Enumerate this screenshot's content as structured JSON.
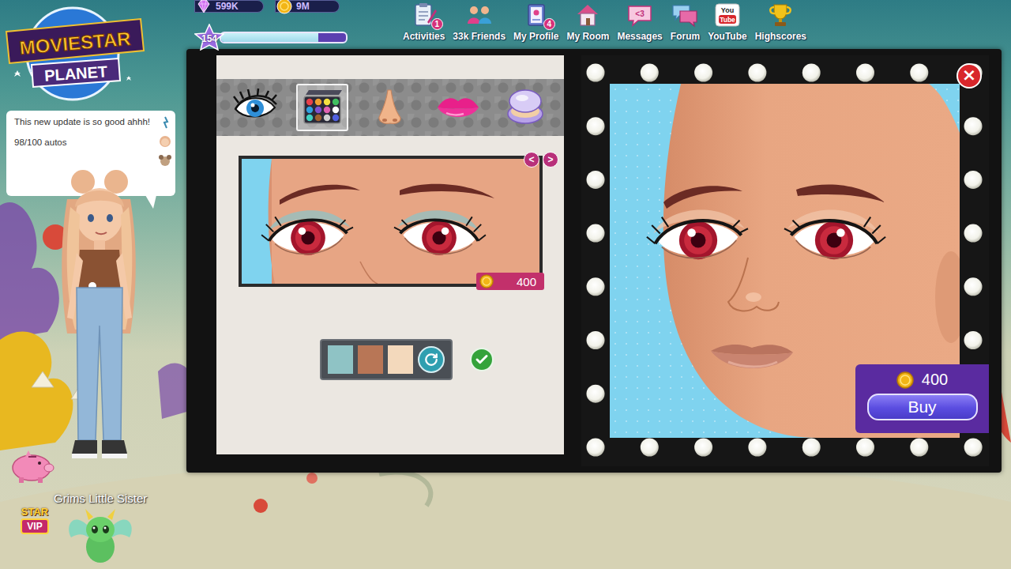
{
  "hud": {
    "diamonds": "599K",
    "coins": "9M",
    "level": "154",
    "xp": 0.78
  },
  "logo": {
    "top": "MOVIESTAR",
    "bottom": "PLANET"
  },
  "nav": [
    {
      "label": "Activities",
      "badge": "1"
    },
    {
      "label": "33k Friends"
    },
    {
      "label": "My Profile",
      "badge": "4"
    },
    {
      "label": "My Room"
    },
    {
      "label": "Messages",
      "icon_text": [
        "<3"
      ]
    },
    {
      "label": "Forum"
    },
    {
      "label": "YouTube",
      "icon_text": [
        "You",
        "Tube"
      ]
    },
    {
      "label": "Highscores"
    }
  ],
  "chat": {
    "lines": [
      "This new update is so good ahhh!",
      "98/100 autos"
    ]
  },
  "player": {
    "name": "Grims Little Sister",
    "vip_top": "STAR",
    "vip_bottom": "VIP"
  },
  "makeup_dialog": {
    "close": "×",
    "tabs": [
      {
        "kind": "eyes",
        "selected": false
      },
      {
        "kind": "eyeshadow",
        "selected": true
      },
      {
        "kind": "nose",
        "selected": false
      },
      {
        "kind": "lips",
        "selected": false
      },
      {
        "kind": "blush",
        "selected": false
      }
    ],
    "preview": {
      "prev": "<",
      "next": ">",
      "price": "400"
    },
    "swatches": [
      {
        "color": "#8fc3c5"
      },
      {
        "color": "#b87656"
      },
      {
        "color": "#f3d9bc"
      }
    ],
    "mirror": {
      "price": "400",
      "buy": "Buy"
    }
  }
}
